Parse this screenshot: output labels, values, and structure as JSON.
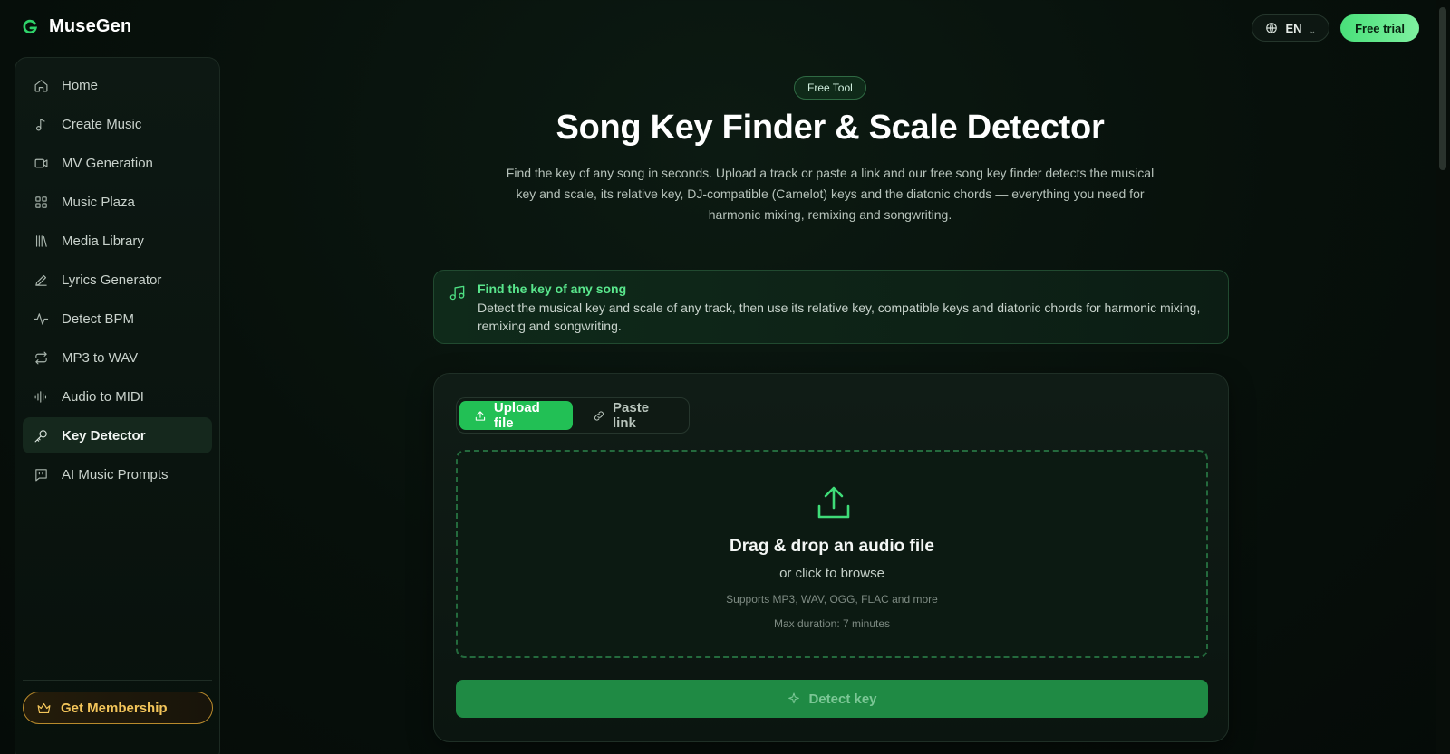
{
  "app": {
    "name": "MuseGen",
    "lang_label": "EN",
    "free_trial_label": "Free trial"
  },
  "sidebar": {
    "items": [
      {
        "label": "Home",
        "icon": "home-icon"
      },
      {
        "label": "Create Music",
        "icon": "music-note-icon"
      },
      {
        "label": "MV Generation",
        "icon": "video-camera-icon"
      },
      {
        "label": "Music Plaza",
        "icon": "grid-icon"
      },
      {
        "label": "Media Library",
        "icon": "library-icon"
      },
      {
        "label": "Lyrics Generator",
        "icon": "pen-icon"
      },
      {
        "label": "Detect BPM",
        "icon": "pulse-icon"
      },
      {
        "label": "MP3 to WAV",
        "icon": "convert-icon"
      },
      {
        "label": "Audio to MIDI",
        "icon": "waveform-icon"
      },
      {
        "label": "Key Detector",
        "icon": "key-icon",
        "active": true
      },
      {
        "label": "AI Music Prompts",
        "icon": "prompt-icon"
      }
    ],
    "membership_label": "Get Membership"
  },
  "main": {
    "badge": "Free Tool",
    "title": "Song Key Finder & Scale Detector",
    "subtitle": "Find the key of any song in seconds. Upload a track or paste a link and our free song key finder detects the musical key and scale, its relative key, DJ-compatible (Camelot) keys and the diatonic chords — everything you need for harmonic mixing, remixing and songwriting.",
    "info": {
      "title": "Find the key of any song",
      "text": "Detect the musical key and scale of any track, then use its relative key, compatible keys and diatonic chords for harmonic mixing, remixing and songwriting."
    },
    "tabs": {
      "upload": "Upload file",
      "paste": "Paste link"
    },
    "dropzone": {
      "title": "Drag & drop an audio file",
      "sub": "or click to browse",
      "supports": "Supports MP3, WAV, OGG, FLAC and more",
      "max": "Max duration: 7 minutes"
    },
    "detect_label": "Detect key"
  },
  "colors": {
    "accent": "#22c055",
    "membership": "#f3c55a",
    "background": "#07100b"
  }
}
